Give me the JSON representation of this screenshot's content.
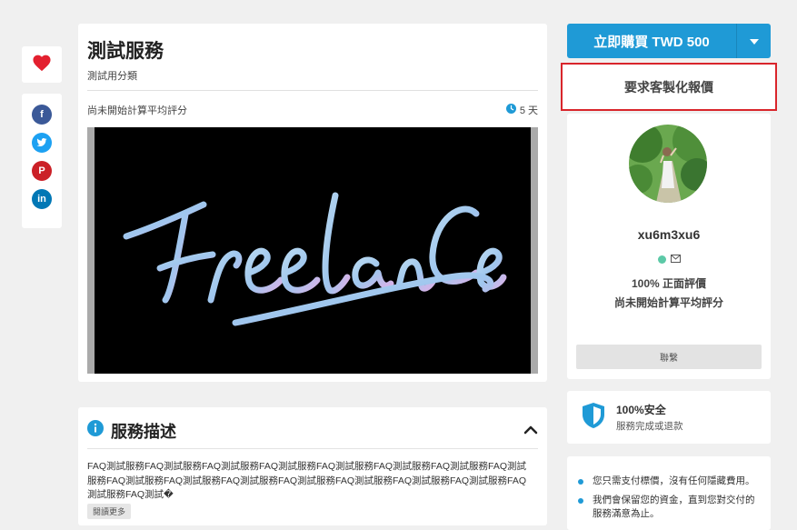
{
  "service": {
    "title": "測試服務",
    "category": "測試用分類",
    "rating_status": "尚未開始計算平均評分",
    "delivery": "5 天"
  },
  "description": {
    "title": "服務描述",
    "text": "FAQ測試服務FAQ測試服務FAQ測試服務FAQ測試服務FAQ測試服務FAQ測試服務FAQ測試服務FAQ測試服務FAQ測試服務FAQ測試服務FAQ測試服務FAQ測試服務FAQ測試服務FAQ測試服務FAQ測試服務FAQ測試服務FAQ測試�",
    "read_more": "閱讀更多"
  },
  "purchase": {
    "buy_label": "立即購買 TWD 500",
    "quote_label": "要求客製化報價"
  },
  "seller": {
    "username": "xu6m3xu6",
    "positive_rating": "100% 正面評價",
    "avg_rating": "尚未開始計算平均評分",
    "contact_label": "聯繫"
  },
  "safety": {
    "title": "100%安全",
    "subtitle": "服務完成或退款"
  },
  "guarantees": [
    "您只需支付標價，沒有任何隱藏費用。",
    "我們會保留您的資金，直到您對交付的服務滿意為止。"
  ],
  "cover_image": {
    "lettering": "Freelance"
  },
  "colors": {
    "accent": "#1f9ad6",
    "highlight_border": "#d9252b",
    "heart": "#e3202f",
    "online": "#5cc9a7"
  }
}
